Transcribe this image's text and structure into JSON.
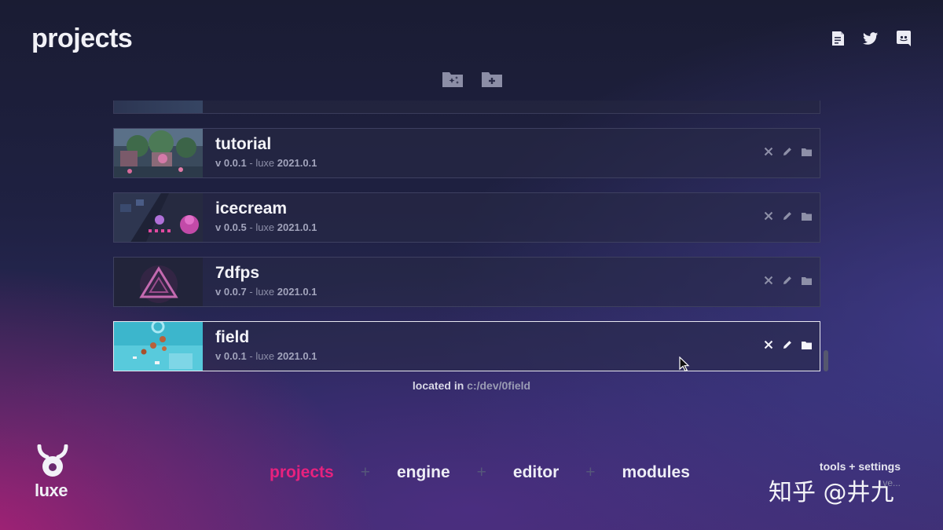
{
  "header": {
    "title": "projects"
  },
  "top_icons": [
    "notes-icon",
    "twitter-icon",
    "discord-icon"
  ],
  "folder_actions": [
    "new-project-folder-icon",
    "add-folder-icon"
  ],
  "projects": [
    {
      "name": "tutorial",
      "version": "v 0.0.1",
      "sep": " - luxe ",
      "luxe_version": "2021.0.1"
    },
    {
      "name": "icecream",
      "version": "v 0.0.5",
      "sep": " - luxe ",
      "luxe_version": "2021.0.1"
    },
    {
      "name": "7dfps",
      "version": "v 0.0.7",
      "sep": " - luxe ",
      "luxe_version": "2021.0.1"
    },
    {
      "name": "field",
      "version": "v 0.0.1",
      "sep": " - luxe ",
      "luxe_version": "2021.0.1",
      "selected": true
    }
  ],
  "location": {
    "label": "located in ",
    "path": "c:/dev/0field"
  },
  "logo": {
    "text": "luxe"
  },
  "nav": {
    "tabs": [
      "projects",
      "engine",
      "editor",
      "modules"
    ],
    "active": "projects",
    "separator": "+"
  },
  "tools": {
    "label": "tools + settings",
    "version": "ve..."
  },
  "watermark": "知乎 @井九",
  "colors": {
    "accent": "#e8217e",
    "bg_top": "#1a1c33",
    "bg_magenta": "#b02076"
  }
}
